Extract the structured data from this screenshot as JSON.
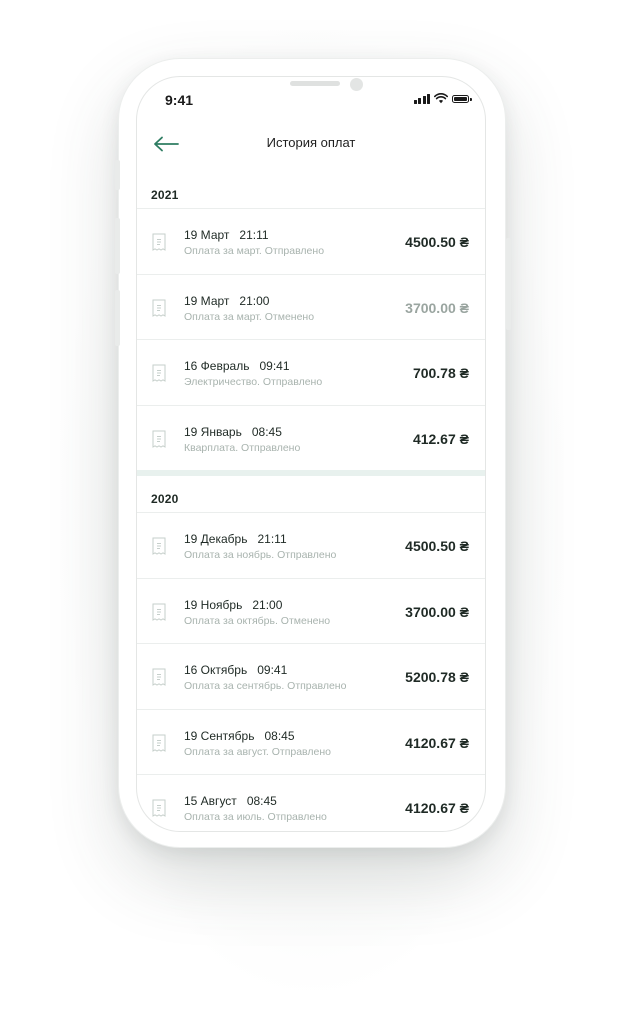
{
  "status_bar": {
    "time": "9:41"
  },
  "header": {
    "title": "История оплат"
  },
  "sections": [
    {
      "year": "2021",
      "items": [
        {
          "date": "19 Март",
          "time": "21:11",
          "desc": "Оплата за март. Отправлено",
          "amount": "4500.50 ₴",
          "muted": false
        },
        {
          "date": "19 Март",
          "time": "21:00",
          "desc": "Оплата за март. Отменено",
          "amount": "3700.00 ₴",
          "muted": true
        },
        {
          "date": "16 Февраль",
          "time": "09:41",
          "desc": "Электричество. Отправлено",
          "amount": "700.78 ₴",
          "muted": false
        },
        {
          "date": "19 Январь",
          "time": "08:45",
          "desc": "Кварплата. Отправлено",
          "amount": "412.67 ₴",
          "muted": false
        }
      ]
    },
    {
      "year": "2020",
      "items": [
        {
          "date": "19 Декабрь",
          "time": "21:11",
          "desc": "Оплата за ноябрь. Отправлено",
          "amount": "4500.50 ₴",
          "muted": false
        },
        {
          "date": "19 Ноябрь",
          "time": "21:00",
          "desc": "Оплата за октябрь. Отменено",
          "amount": "3700.00 ₴",
          "muted": false
        },
        {
          "date": "16 Октябрь",
          "time": "09:41",
          "desc": "Оплата за сентябрь. Отправлено",
          "amount": "5200.78 ₴",
          "muted": false
        },
        {
          "date": "19 Сентябрь",
          "time": "08:45",
          "desc": "Оплата за август. Отправлено",
          "amount": "4120.67 ₴",
          "muted": false
        },
        {
          "date": "15 Август",
          "time": "08:45",
          "desc": "Оплата за июль. Отправлено",
          "amount": "4120.67 ₴",
          "muted": false
        }
      ]
    }
  ],
  "icons": {
    "back": "arrow-left-icon",
    "row": "receipt-icon",
    "signal": "signal-icon",
    "wifi": "wifi-icon",
    "battery": "battery-icon"
  },
  "colors": {
    "accent": "#2e7d62",
    "text": "#1f2a25",
    "muted": "#a8b3ae",
    "separator": "#e8f1ee"
  }
}
